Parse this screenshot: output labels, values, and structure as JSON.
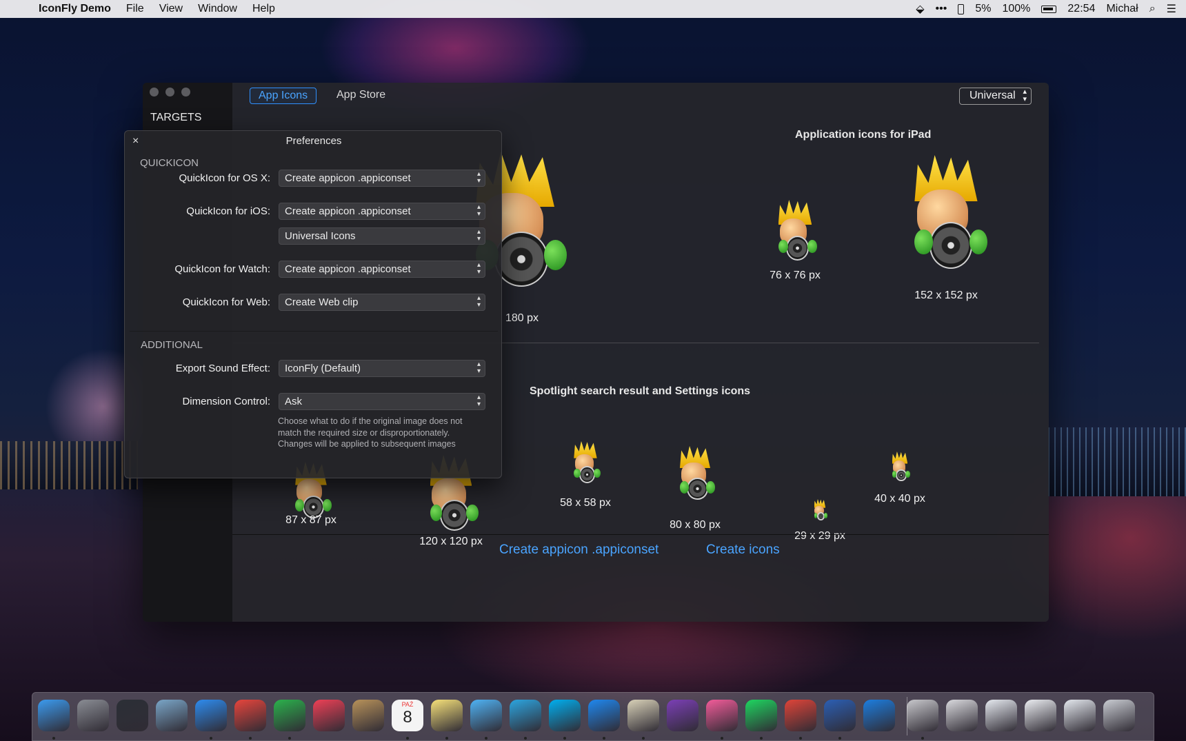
{
  "menubar": {
    "apple": "",
    "app_name": "IconFly Demo",
    "menus": [
      "File",
      "View",
      "Window",
      "Help"
    ],
    "status": {
      "dropbox": "⬙",
      "more": "•••",
      "phone_battery": "5%",
      "battery": "100%",
      "time": "22:54",
      "user": "Michał",
      "search": "⌕",
      "list": "☰"
    }
  },
  "window": {
    "sidebar": {
      "targets_label": "TARGETS"
    },
    "tabs": [
      {
        "label": "App Icons",
        "active": true
      },
      {
        "label": "App Store",
        "active": false
      }
    ],
    "device_select": "Universal",
    "sections": {
      "ipad_title": "Application icons for iPad",
      "spotlight_title": "Spotlight search result and Settings icons"
    },
    "icons": {
      "ipad": [
        {
          "label": "76 x 76 px"
        },
        {
          "label": "152 x 152 px"
        }
      ],
      "partial_label": "180 px",
      "spotlight": [
        {
          "label": "87 x 87 px"
        },
        {
          "label": "120 x 120 px"
        },
        {
          "label": "58 x 58 px"
        },
        {
          "label": "80 x 80 px"
        },
        {
          "label": "29 x 29 px"
        },
        {
          "label": "40 x 40 px"
        }
      ]
    },
    "footer": {
      "create_appiconset": "Create appicon .appiconset",
      "create_icons": "Create icons"
    }
  },
  "preferences": {
    "close": "×",
    "title": "Preferences",
    "quickicon_group": "QUICKICON",
    "additional_group": "ADDITIONAL",
    "rows": {
      "osx": {
        "label": "QuickIcon for OS X:",
        "value": "Create appicon .appiconset"
      },
      "ios": {
        "label": "QuickIcon for iOS:",
        "value": "Create appicon .appiconset"
      },
      "ios_variant": {
        "value": "Universal Icons"
      },
      "watch": {
        "label": "QuickIcon for Watch:",
        "value": "Create appicon .appiconset"
      },
      "web": {
        "label": "QuickIcon for Web:",
        "value": "Create Web clip"
      },
      "sound": {
        "label": "Export Sound Effect:",
        "value": "IconFly (Default)"
      },
      "dimension": {
        "label": "Dimension Control:",
        "value": "Ask"
      }
    },
    "dimension_help": "Choose what to do if the original image does not match the required size or disproportionately. Changes will be applied to subsequent images"
  },
  "dock": {
    "calendar_month": "PAŹ",
    "calendar_day": "8",
    "items": [
      {
        "name": "finder",
        "color": "#3b9bf0"
      },
      {
        "name": "launchpad",
        "color": "#8a8d94"
      },
      {
        "name": "mission-control",
        "color": "#2b2f36"
      },
      {
        "name": "mail-stamp",
        "color": "#7aa6c8"
      },
      {
        "name": "safari",
        "color": "#2d8cf0"
      },
      {
        "name": "chrome",
        "color": "#e8453c"
      },
      {
        "name": "feedly",
        "color": "#2bb24c"
      },
      {
        "name": "pocket",
        "color": "#ef4056"
      },
      {
        "name": "contacts",
        "color": "#b8925a"
      },
      {
        "name": "calendar",
        "color": "#f4f4f4"
      },
      {
        "name": "notes",
        "color": "#f7e27a"
      },
      {
        "name": "messages",
        "color": "#4fb3f5"
      },
      {
        "name": "telegram",
        "color": "#2ca5e0"
      },
      {
        "name": "skype",
        "color": "#00aff0"
      },
      {
        "name": "messenger",
        "color": "#1e88f0"
      },
      {
        "name": "preview",
        "color": "#d9d2b8"
      },
      {
        "name": "onenote",
        "color": "#7b3fb6"
      },
      {
        "name": "itunes",
        "color": "#f45c9a"
      },
      {
        "name": "spotify",
        "color": "#1ed760"
      },
      {
        "name": "downloader",
        "color": "#e04438"
      },
      {
        "name": "word",
        "color": "#2b5fb4"
      },
      {
        "name": "xcode",
        "color": "#1c7ee0"
      },
      {
        "name": "iconfly",
        "color": "#c8c8cc"
      },
      {
        "name": "people-doc",
        "color": "#dadade"
      },
      {
        "name": "window-thumb-1",
        "color": "#e6eaf0"
      },
      {
        "name": "window-thumb-2",
        "color": "#eceef2"
      },
      {
        "name": "window-thumb-3",
        "color": "#e4e8ee"
      },
      {
        "name": "trash",
        "color": "#c9ccd2"
      }
    ]
  }
}
